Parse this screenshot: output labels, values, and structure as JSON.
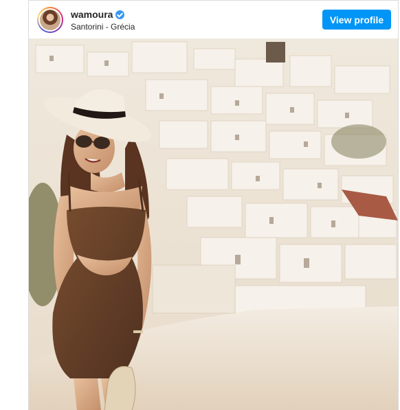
{
  "post": {
    "username": "wamoura",
    "verified": true,
    "location": "Santorini - Grécia",
    "view_profile_label": "View profile"
  },
  "colors": {
    "button": "#0095f6",
    "verified_badge": "#3897f0",
    "text": "#262626"
  },
  "icons": {
    "verified": "verified-check-icon"
  }
}
